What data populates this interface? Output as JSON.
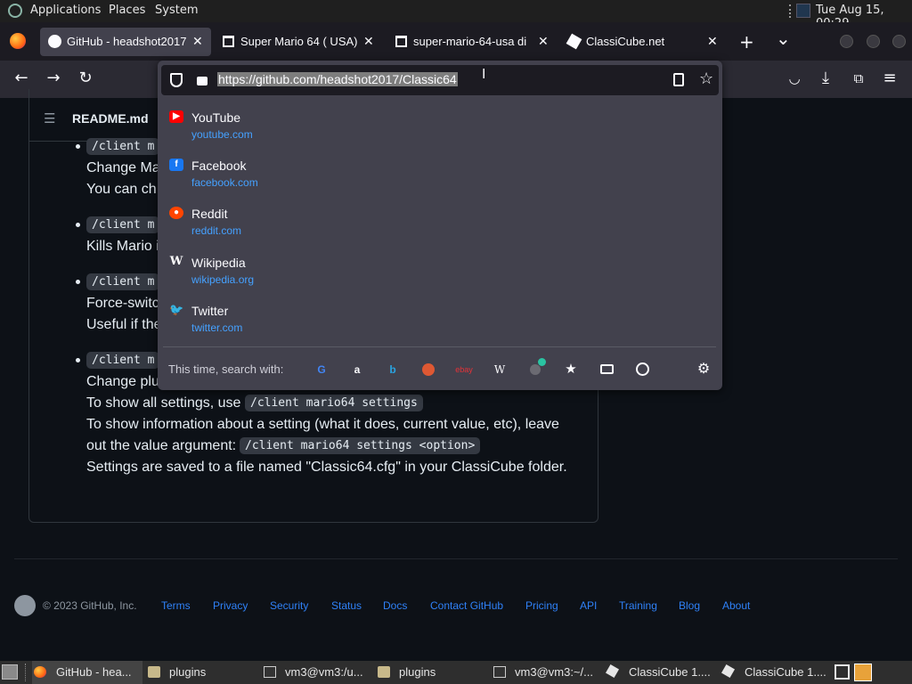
{
  "system_bar": {
    "applications": "Applications",
    "places": "Places",
    "system": "System",
    "clock": "Tue Aug 15, 00:29"
  },
  "tabs": [
    {
      "label": "GitHub - headshot2017",
      "active": true
    },
    {
      "label": "Super Mario 64 ( USA)",
      "active": false
    },
    {
      "label": "super-mario-64-usa di",
      "active": false
    },
    {
      "label": "ClassiCube.net",
      "active": false
    }
  ],
  "tab_close": "✕",
  "new_tab": "+",
  "tab_list": "⌄",
  "address": {
    "url": "https://github.com/headshot2017/Classic64"
  },
  "page": {
    "readme_title": "README.md",
    "items": [
      {
        "code": "/client m",
        "lines": [
          "Change Ma",
          "You can ch"
        ]
      },
      {
        "code": "/client m",
        "lines": [
          "Kills Mario i"
        ]
      },
      {
        "code": "/client m",
        "lines": [
          "Force-switc",
          "Useful if the"
        ]
      },
      {
        "code": "/client m",
        "lines": [
          "Change plu"
        ]
      }
    ],
    "line_show_all": "To show all settings, use",
    "code_settings": "/client mario64 settings",
    "line_info": "To show information about a setting (what it does, current value, etc), leave",
    "line_out": "out the value argument:",
    "code_option": "/client mario64 settings <option>",
    "line_saved": "Settings are saved to a file named \"Classic64.cfg\" in your ClassiCube folder."
  },
  "footer": {
    "copyright": "© 2023 GitHub, Inc.",
    "links": [
      "Terms",
      "Privacy",
      "Security",
      "Status",
      "Docs",
      "Contact GitHub",
      "Pricing",
      "API",
      "Training",
      "Blog",
      "About"
    ]
  },
  "suggestions": [
    {
      "title": "YouTube",
      "url": "youtube.com",
      "icon": "youtube-icon",
      "color": "#ff0000"
    },
    {
      "title": "Facebook",
      "url": "facebook.com",
      "icon": "facebook-icon",
      "color": "#1877f2"
    },
    {
      "title": "Reddit",
      "url": "reddit.com",
      "icon": "reddit-icon",
      "color": "#ff4500"
    },
    {
      "title": "Wikipedia",
      "url": "wikipedia.org",
      "icon": "wikipedia-icon",
      "color": "#ffffff"
    },
    {
      "title": "Twitter",
      "url": "twitter.com",
      "icon": "twitter-icon",
      "color": "#1d9bf0"
    }
  ],
  "search_row": {
    "label": "This time, search with:",
    "engines": [
      "google-icon",
      "amazon-icon",
      "bing-icon",
      "duckduckgo-icon",
      "ebay-icon",
      "wikipedia-icon",
      "add-engine-icon",
      "bookmarks-icon",
      "tabs-icon",
      "history-icon"
    ]
  },
  "taskbar": [
    {
      "label": "GitHub - hea...",
      "icon": "firefox-icon"
    },
    {
      "label": "plugins",
      "icon": "folder-icon"
    },
    {
      "label": "vm3@vm3:/u...",
      "icon": "terminal-icon"
    },
    {
      "label": "plugins",
      "icon": "folder-icon"
    },
    {
      "label": "vm3@vm3:~/...",
      "icon": "terminal-icon"
    },
    {
      "label": "ClassiCube 1....",
      "icon": "classicube-icon"
    },
    {
      "label": "ClassiCube 1....",
      "icon": "classicube-icon"
    }
  ],
  "colors": {
    "accent_link": "#2f81f7",
    "suggestion_url": "#45a1ff",
    "url_selection": "#7d7d7d"
  }
}
